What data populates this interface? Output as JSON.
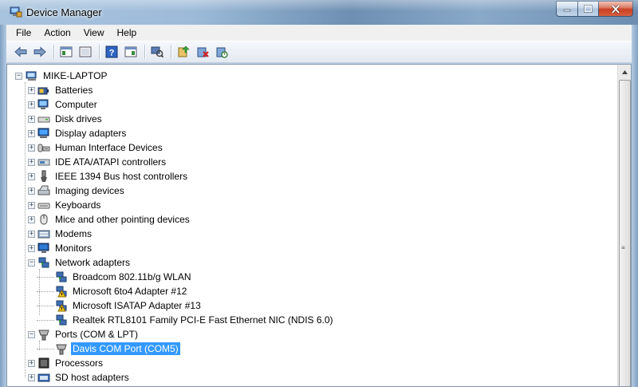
{
  "window": {
    "title": "Device Manager"
  },
  "menu": [
    "File",
    "Action",
    "View",
    "Help"
  ],
  "toolbar": {
    "buttons": [
      "back-icon",
      "forward-icon",
      "show-hide-console-tree-icon",
      "properties-icon",
      "help-icon",
      "show-hide-action-pane-icon",
      "scan-hardware-icon",
      "update-driver-icon",
      "uninstall-icon",
      "disable-icon"
    ]
  },
  "tree": {
    "root": "MIKE-LAPTOP",
    "categories": [
      {
        "label": "Batteries",
        "icon": "battery-icon"
      },
      {
        "label": "Computer",
        "icon": "computer-icon"
      },
      {
        "label": "Disk drives",
        "icon": "disk-drive-icon"
      },
      {
        "label": "Display adapters",
        "icon": "display-adapter-icon"
      },
      {
        "label": "Human Interface Devices",
        "icon": "hid-icon"
      },
      {
        "label": "IDE ATA/ATAPI controllers",
        "icon": "ide-controller-icon"
      },
      {
        "label": "IEEE 1394 Bus host controllers",
        "icon": "ieee1394-icon"
      },
      {
        "label": "Imaging devices",
        "icon": "imaging-icon"
      },
      {
        "label": "Keyboards",
        "icon": "keyboard-icon"
      },
      {
        "label": "Mice and other pointing devices",
        "icon": "mouse-icon"
      },
      {
        "label": "Modems",
        "icon": "modem-icon"
      },
      {
        "label": "Monitors",
        "icon": "monitor-icon"
      },
      {
        "label": "Network adapters",
        "icon": "network-adapter-icon"
      },
      {
        "label": "Ports (COM & LPT)",
        "icon": "port-icon"
      },
      {
        "label": "Processors",
        "icon": "processor-icon"
      },
      {
        "label": "SD host adapters",
        "icon": "sd-adapter-icon"
      }
    ],
    "network_children": [
      {
        "label": "Broadcom 802.11b/g WLAN",
        "warning": false
      },
      {
        "label": "Microsoft 6to4 Adapter #12",
        "warning": true
      },
      {
        "label": "Microsoft ISATAP Adapter #13",
        "warning": true
      },
      {
        "label": "Realtek RTL8101 Family PCI-E Fast Ethernet NIC (NDIS 6.0)",
        "warning": false
      }
    ],
    "port_children": [
      {
        "label": "Davis COM Port (COM5)",
        "selected": true
      }
    ]
  }
}
